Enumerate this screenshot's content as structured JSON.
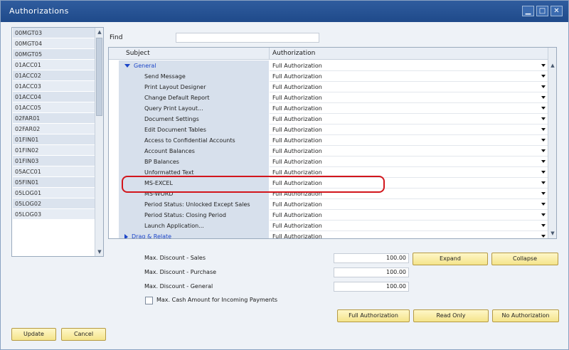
{
  "window": {
    "title": "Authorizations",
    "min": "▁",
    "max": "□",
    "close": "✕"
  },
  "users": [
    "00MGT03",
    "00MGT04",
    "00MGT05",
    "01ACC01",
    "01ACC02",
    "01ACC03",
    "01ACC04",
    "01ACC05",
    "02FAR01",
    "02FAR02",
    "01FIN01",
    "01FIN02",
    "01FIN03",
    "05ACC01",
    "05FIN01",
    "05LOG01",
    "05LOG02",
    "05LOG03"
  ],
  "find": {
    "label": "Find",
    "value": ""
  },
  "grid": {
    "headers": {
      "subject": "Subject",
      "authorization": "Authorization"
    },
    "rows": [
      {
        "subject": "General",
        "auth": "Full Authorization",
        "kind": "group-open"
      },
      {
        "subject": "Send Message",
        "auth": "Full Authorization"
      },
      {
        "subject": "Print Layout Designer",
        "auth": "Full Authorization"
      },
      {
        "subject": "Change Default Report",
        "auth": "Full Authorization"
      },
      {
        "subject": "Query Print Layout...",
        "auth": "Full Authorization"
      },
      {
        "subject": "Document Settings",
        "auth": "Full Authorization"
      },
      {
        "subject": "Edit Document Tables",
        "auth": "Full Authorization"
      },
      {
        "subject": "Access to Confidential Accounts",
        "auth": "Full Authorization"
      },
      {
        "subject": "Account Balances",
        "auth": "Full Authorization"
      },
      {
        "subject": "BP Balances",
        "auth": "Full Authorization"
      },
      {
        "subject": "Unformatted Text",
        "auth": "Full Authorization"
      },
      {
        "subject": "MS-EXCEL",
        "auth": "Full Authorization"
      },
      {
        "subject": "MS-WORD",
        "auth": "Full Authorization"
      },
      {
        "subject": "Period Status: Unlocked Except Sales",
        "auth": "Full Authorization"
      },
      {
        "subject": "Period Status: Closing Period",
        "auth": "Full Authorization"
      },
      {
        "subject": "Launch Application...",
        "auth": "Full Authorization"
      },
      {
        "subject": "Drag & Relate",
        "auth": "Full Authorization",
        "kind": "group-closed"
      }
    ]
  },
  "discounts": [
    {
      "label": "Max. Discount - Sales",
      "value": "100.00"
    },
    {
      "label": "Max. Discount - Purchase",
      "value": "100.00"
    },
    {
      "label": "Max. Discount - General",
      "value": "100.00"
    }
  ],
  "cash_checkbox": {
    "label": "Max. Cash Amount for Incoming Payments",
    "checked": false
  },
  "buttons": {
    "expand": "Expand",
    "collapse": "Collapse",
    "full_authorization": "Full Authorization",
    "read_only": "Read Only",
    "no_authorization": "No Authorization",
    "update": "Update",
    "cancel": "Cancel"
  },
  "colors": {
    "highlight": "#d2161c",
    "title_bar": "#1f4a8a",
    "group_text": "#1d46c8"
  }
}
